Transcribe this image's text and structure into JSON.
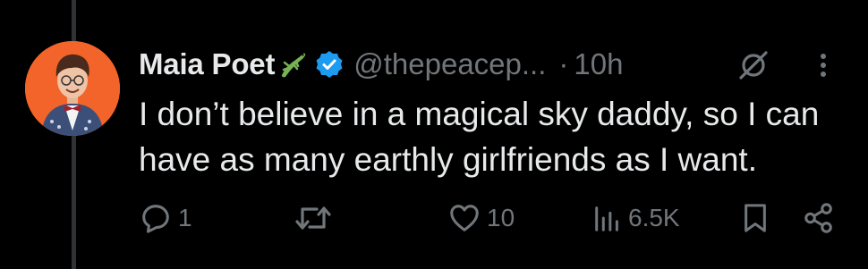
{
  "post": {
    "author_name": "Maia Poet",
    "author_emoji": "lizard",
    "verified": true,
    "handle": "@thepeacep...",
    "separator": "·",
    "time": "10h",
    "text": "I don’t believe in a magical sky daddy, so I can have as many earthly girlfriends as I want.",
    "stats": {
      "replies": "1",
      "reposts": "",
      "likes": "10",
      "views": "6.5K"
    }
  },
  "icons": {
    "avatar": "avatar-person-red-background",
    "grok": "grok-slash-icon",
    "more": "more-vertical-icon",
    "reply": "reply-bubble-icon",
    "repost": "repost-arrows-icon",
    "like": "heart-icon",
    "views": "views-bar-chart-icon",
    "bookmark": "bookmark-icon",
    "share": "share-icon"
  },
  "colors": {
    "background": "#000000",
    "text": "#e7e9ea",
    "muted": "#71767b",
    "verified": "#1d9bf0",
    "avatar_bg": "#f2642a"
  }
}
